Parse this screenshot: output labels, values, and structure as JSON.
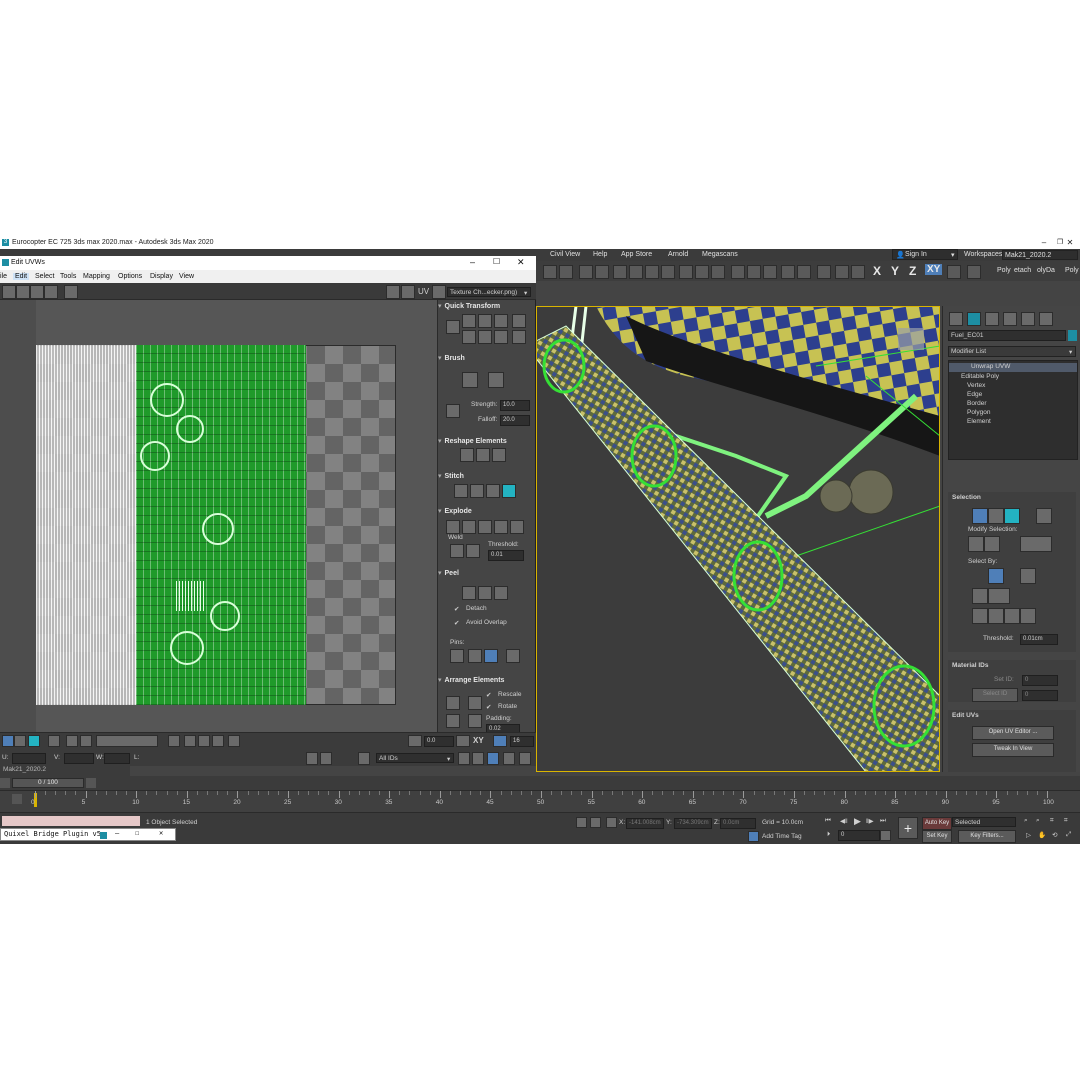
{
  "app": {
    "title": "Eurocopter EC 725 3ds max 2020.max - Autodesk 3ds Max 2020",
    "menu": [
      "Civil View",
      "Help",
      "App Store",
      "Arnold",
      "Megascans"
    ],
    "sign_in": "Sign In",
    "workspaces_label": "Workspaces:",
    "workspace": "Mak21_2020.2",
    "ribbon_tabs": [
      "Poly",
      "etach",
      "olyDa",
      "Poly"
    ],
    "axes": [
      "X",
      "Y",
      "Z",
      "XY"
    ]
  },
  "uvw": {
    "title": "Edit UVWs",
    "menu": [
      "ile",
      "Edit",
      "Select",
      "Tools",
      "Mapping",
      "Options",
      "Display",
      "View"
    ],
    "uv_label": "UV",
    "texture_select": "Texture Ch...ecker.png)",
    "panels": {
      "quick_transform": "Quick Transform",
      "brush": "Brush",
      "strength_label": "Strength:",
      "strength": "10.0",
      "falloff_label": "Falloff:",
      "falloff": "20.0",
      "reshape": "Reshape Elements",
      "stitch": "Stitch",
      "explode": "Explode",
      "weld": "Weld",
      "threshold_label": "Threshold:",
      "threshold": "0.01",
      "peel": "Peel",
      "detach": "Detach",
      "avoid_overlap": "Avoid Overlap",
      "pins": "Pins:",
      "arrange": "Arrange Elements",
      "rescale": "Rescale",
      "rotate": "Rotate",
      "padding_label": "Padding:",
      "padding": "0.02"
    },
    "bottom": {
      "u_label": "U:",
      "v_label": "V:",
      "w_label": "W:",
      "l_label": "L:",
      "angle": "0.0",
      "xy": "XY",
      "grid_val": "16",
      "ids": "All IDs"
    }
  },
  "command_panel": {
    "object_name": "Fuel_EC01",
    "modifier_list": "Modifier List",
    "stack": [
      "Unwrap UVW",
      "Editable Poly",
      "Vertex",
      "Edge",
      "Border",
      "Polygon",
      "Element"
    ],
    "selection": "Selection",
    "modify_selection": "Modify Selection:",
    "select_by": "Select By:",
    "threshold_label": "Threshold:",
    "threshold": "0.01cm",
    "material_ids": "Material IDs",
    "set_id": "Set ID:",
    "set_id_val": "0",
    "select_id": "Select ID",
    "select_id_val": "0",
    "edit_uvs": "Edit UVs",
    "open_uv_editor": "Open UV Editor ...",
    "tweak_in_view": "Tweak In View"
  },
  "timeline": {
    "frame": "0 / 100",
    "layer": "Mak21_2020.2",
    "ticks": [
      "0",
      "5",
      "10",
      "15",
      "20",
      "25",
      "30",
      "35",
      "40",
      "45",
      "50",
      "55",
      "60",
      "65",
      "70",
      "75",
      "80",
      "85",
      "90",
      "95",
      "100"
    ]
  },
  "status": {
    "selected": "1 Object Selected",
    "x_label": "X:",
    "x": "-141.008cm",
    "y_label": "Y:",
    "y": "-734.309cm",
    "z_label": "Z:",
    "z": "0.0cm",
    "grid": "Grid = 10.0cm",
    "add_time_tag": "Add Time Tag",
    "auto_key": "Auto Key",
    "set_key": "Set Key",
    "selected_mode": "Selected",
    "key_filters": "Key Filters...",
    "frame_field": "0",
    "quixel": "Quixel Bridge Plugin v5"
  },
  "colors": {
    "accent": "#1f9a2a",
    "viewport_bg": "#3c3c3c",
    "ui_bg": "#444444"
  }
}
